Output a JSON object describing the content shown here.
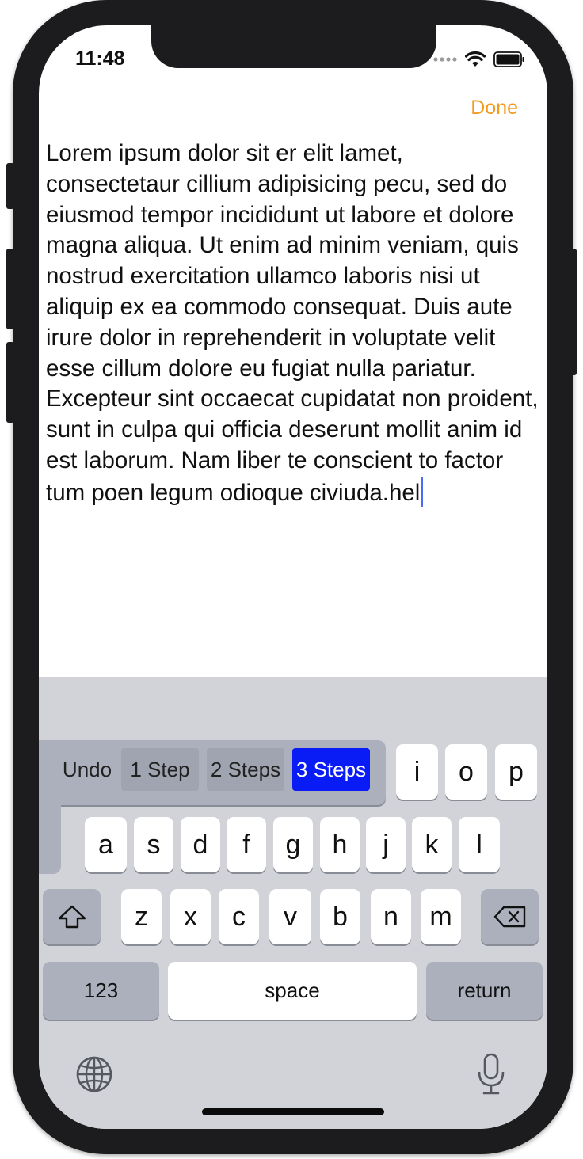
{
  "status_bar": {
    "time": "11:48"
  },
  "nav": {
    "done_label": "Done"
  },
  "editor": {
    "text": "Lorem ipsum dolor sit er elit lamet, consectetaur cillium adipisicing pecu, sed do eiusmod tempor incididunt ut labore et dolore magna aliqua. Ut enim ad minim veniam, quis nostrud exercitation ullamco laboris nisi ut aliquip ex ea commodo consequat. Duis aute irure dolor in reprehenderit in voluptate velit esse cillum dolore eu fugiat nulla pariatur. Excepteur sint occaecat cupidatat non proident, sunt in culpa qui officia deserunt mollit anim id est laborum. Nam liber te conscient to factor tum poen legum odioque civiuda.hel"
  },
  "undo_menu": {
    "undo": "Undo",
    "step1": "1 Step",
    "step2": "2 Steps",
    "step3": "3 Steps"
  },
  "keyboard": {
    "row1": [
      "i",
      "o",
      "p"
    ],
    "row2": [
      "a",
      "s",
      "d",
      "f",
      "g",
      "h",
      "j",
      "k",
      "l"
    ],
    "row3": [
      "z",
      "x",
      "c",
      "v",
      "b",
      "n",
      "m"
    ],
    "numbers_label": "123",
    "space_label": "space",
    "return_label": "return"
  },
  "colors": {
    "accent": "#f29b1f",
    "selected_step": "#0a1cf6",
    "keyboard_bg": "#d1d3d9"
  },
  "icons": [
    "wifi-icon",
    "battery-icon",
    "shift-icon",
    "backspace-icon",
    "globe-icon",
    "microphone-icon"
  ]
}
